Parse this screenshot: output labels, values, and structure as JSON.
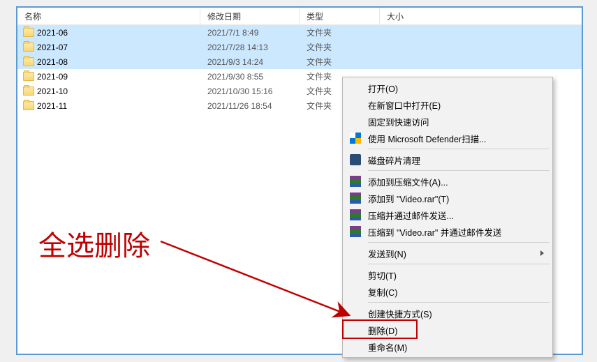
{
  "headers": {
    "name": "名称",
    "date": "修改日期",
    "type": "类型",
    "size": "大小"
  },
  "folder_type": "文件夹",
  "files": {
    "0": {
      "name": "2021-06",
      "date": "2021/7/1 8:49",
      "selected": true
    },
    "1": {
      "name": "2021-07",
      "date": "2021/7/28 14:13",
      "selected": true
    },
    "2": {
      "name": "2021-08",
      "date": "2021/9/3 14:24",
      "selected": true
    },
    "3": {
      "name": "2021-09",
      "date": "2021/9/30 8:55",
      "selected": false
    },
    "4": {
      "name": "2021-10",
      "date": "2021/10/30 15:16",
      "selected": false
    },
    "5": {
      "name": "2021-11",
      "date": "2021/11/26 18:54",
      "selected": false
    }
  },
  "menu": {
    "open": "打开(O)",
    "open_new_window": "在新窗口中打开(E)",
    "pin_quick": "固定到快速访问",
    "defender": "使用 Microsoft Defender扫描...",
    "defrag": "磁盘碎片清理",
    "add_archive": "添加到压缩文件(A)...",
    "add_rar": "添加到 \"Video.rar\"(T)",
    "compress_email": "压缩并通过邮件发送...",
    "compress_rar_email": "压缩到 \"Video.rar\" 并通过邮件发送",
    "send_to": "发送到(N)",
    "cut": "剪切(T)",
    "copy": "复制(C)",
    "shortcut": "创建快捷方式(S)",
    "delete": "删除(D)",
    "rename": "重命名(M)"
  },
  "annotation": "全选删除"
}
